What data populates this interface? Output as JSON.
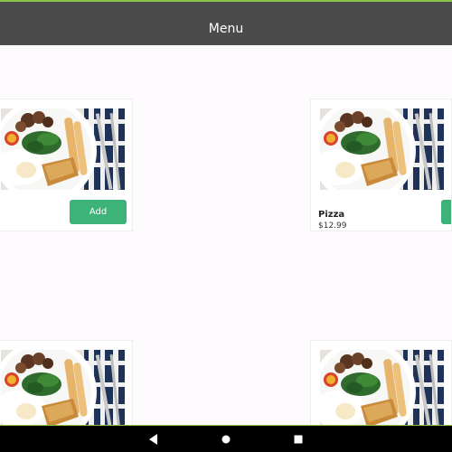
{
  "header": {
    "title": "Menu"
  },
  "colors": {
    "app_bar": "#4b4b4b",
    "accent_line": "#8bc34a",
    "add_button": "#3db37a",
    "background": "#fdfbfd"
  },
  "menu": {
    "items": [
      {
        "add_label": "Add"
      },
      {
        "name": "Pizza",
        "price": "$12.99",
        "add_label": ""
      },
      {},
      {}
    ]
  },
  "nav": {
    "icons": [
      "back-icon",
      "home-icon",
      "recents-icon"
    ]
  }
}
